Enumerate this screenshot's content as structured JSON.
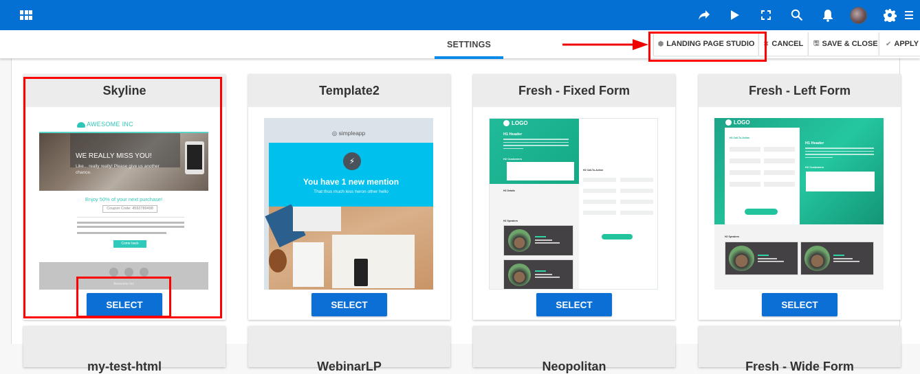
{
  "topbar": {
    "brand_color": "#0470d4",
    "left_icon": "apps-grid-icon",
    "right_icons": [
      "share-icon",
      "play-icon",
      "fullscreen-icon",
      "search-icon",
      "bell-icon",
      "avatar",
      "gear-icon",
      "menu-icon"
    ]
  },
  "subbar": {
    "active_tab": "SETTINGS",
    "accent_color": "#0a8ae8",
    "actions": {
      "landing_page_studio": "LANDING PAGE STUDIO",
      "cancel": "CANCEL",
      "save_close": "SAVE & CLOSE",
      "apply": "APPLY"
    }
  },
  "annotations": {
    "highlight_color": "#ff0000",
    "arrow_points_to": "LANDING PAGE STUDIO"
  },
  "templates": [
    {
      "name": "Skyline",
      "select_label": "SELECT",
      "preview": {
        "logo": "AWESOME INC",
        "headline": "WE REALLY MISS YOU!",
        "body": "Like... really really! Please give us another chance.",
        "offer": "Enjoy 50% of your next purchase!",
        "coupon": "Coupon Code: 4592789498",
        "cta": "Come back",
        "footer": "Awesome Inc"
      }
    },
    {
      "name": "Template2",
      "select_label": "SELECT",
      "preview": {
        "logo": "simpleapp",
        "headline": "You have 1 new mention",
        "sub": "That thus much less heron other hello"
      }
    },
    {
      "name": "Fresh - Fixed Form",
      "select_label": "SELECT",
      "preview": {
        "logo": "LOGO",
        "h1": "H1 Header",
        "customers": "H2 Customers",
        "details": "H2 Details",
        "cta": "H2 Call-To-Action",
        "speakers": "H2 Speakers"
      }
    },
    {
      "name": "Fresh - Left Form",
      "select_label": "SELECT",
      "preview": {
        "logo": "LOGO",
        "cta": "H2 Call-To-Action",
        "h1": "H1 Header",
        "customers": "H2 Customers",
        "speakers": "H2 Speakers"
      }
    }
  ],
  "templates_row2": [
    "my-test-html",
    "WebinarLP",
    "Neopolitan",
    "Fresh - Wide Form"
  ]
}
